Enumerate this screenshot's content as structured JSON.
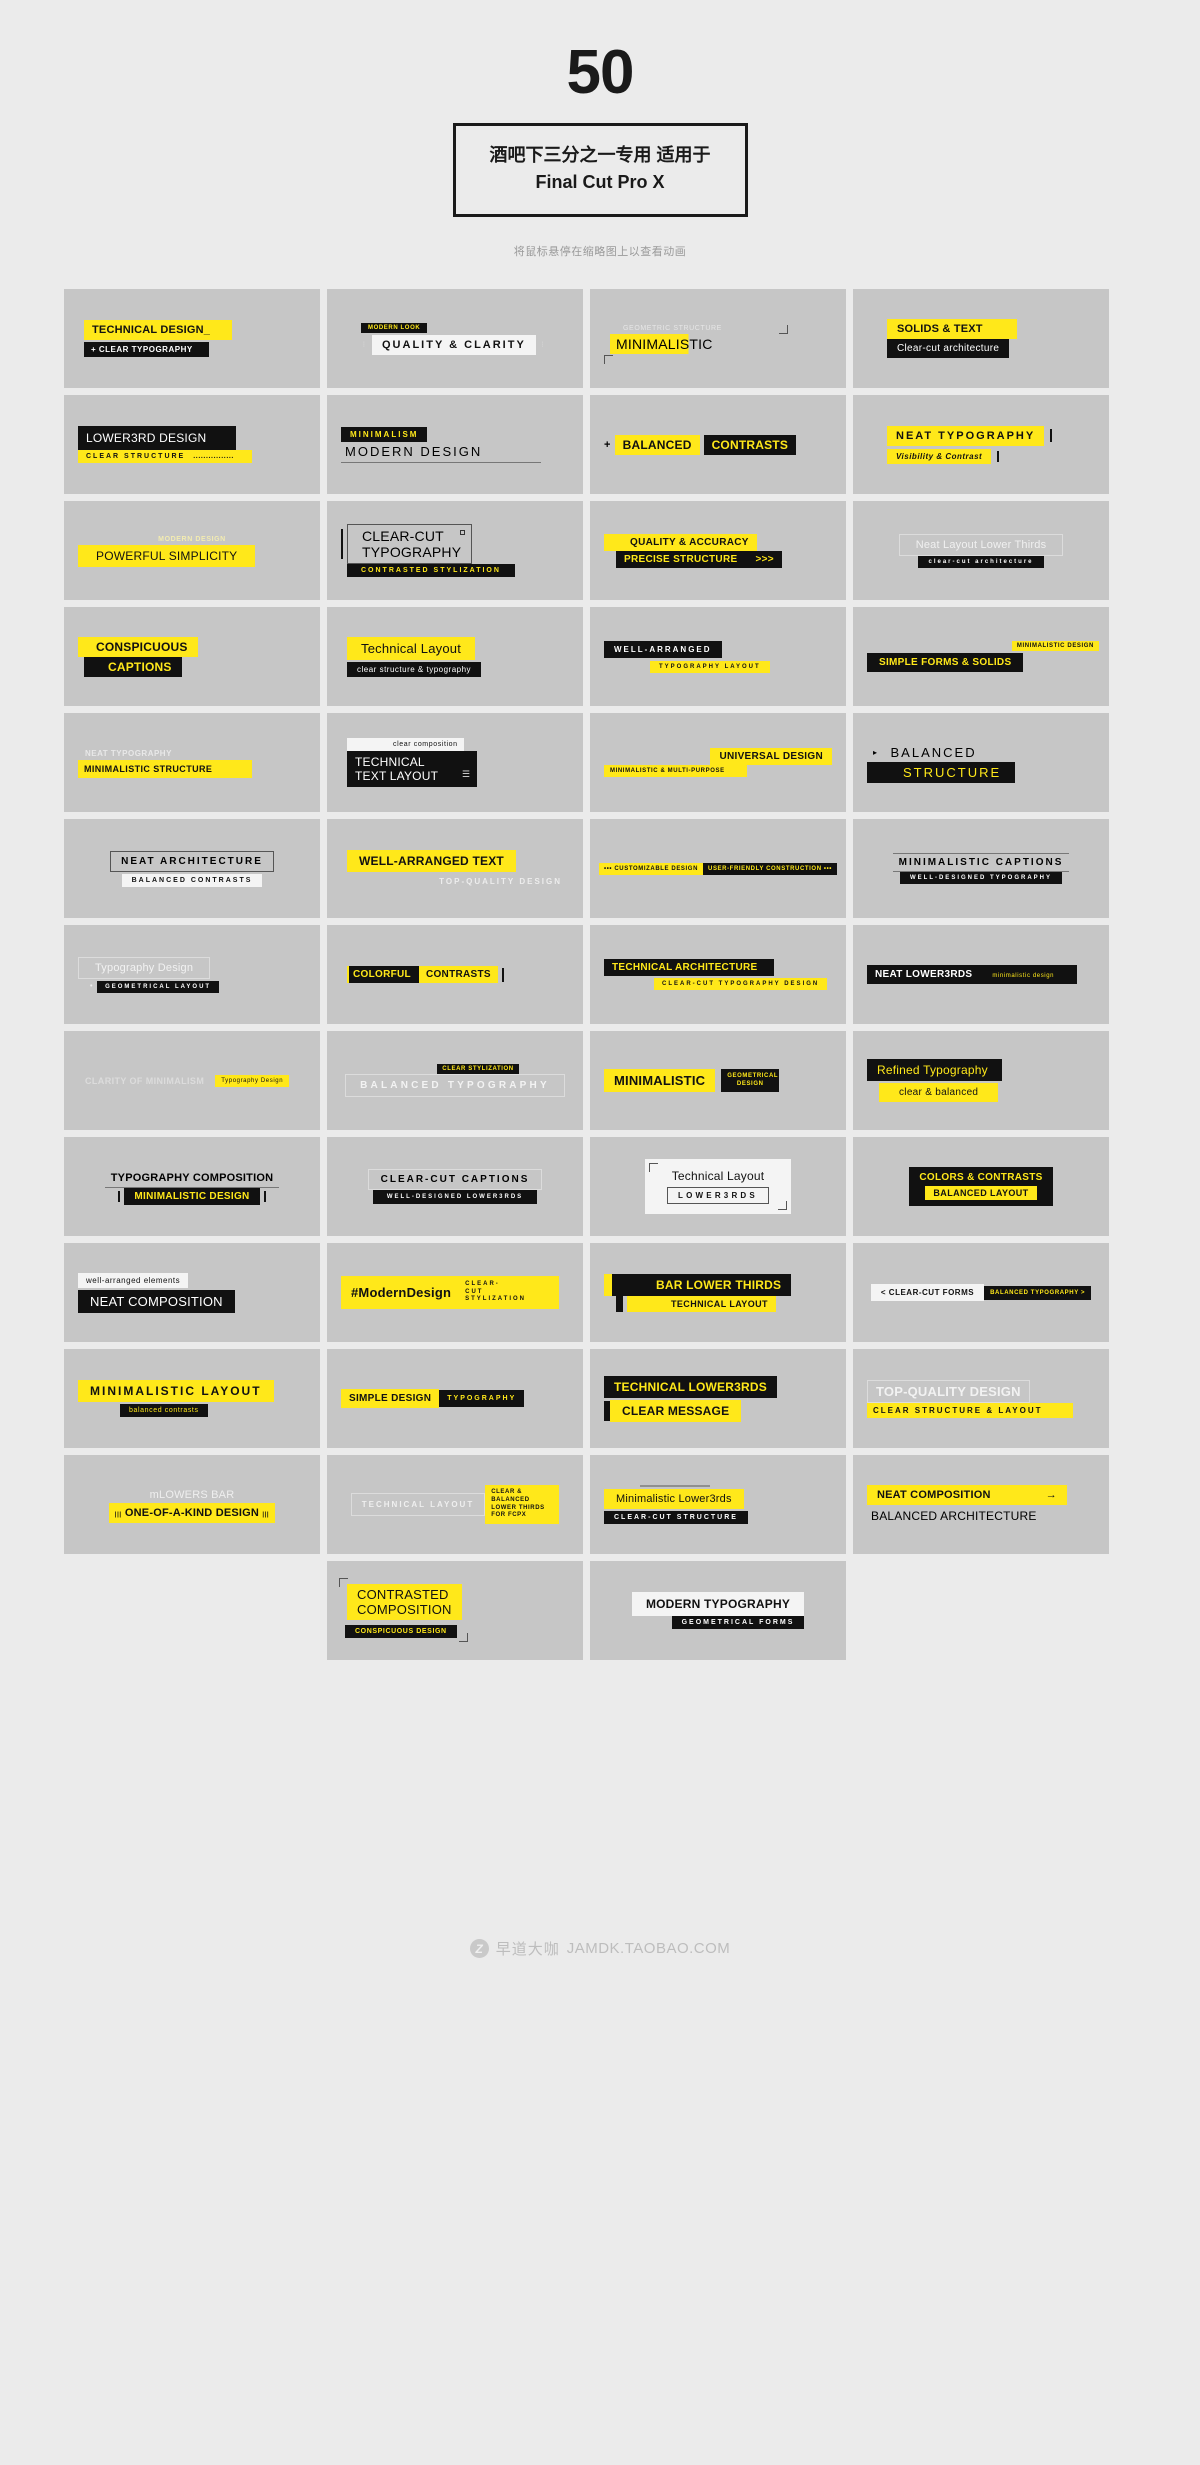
{
  "header": {
    "count": "50",
    "title_line1": "酒吧下三分之一专用 适用于",
    "title_line2": "Final Cut Pro X",
    "hover_note": "将鼠标悬停在缩略图上以查看动画"
  },
  "watermark": {
    "badge": "Z",
    "brand_cn": "早道大咖",
    "url": "JAMDK.TAOBAO.COM"
  },
  "colors": {
    "page_bg": "#ebebeb",
    "cell_bg": "#c6c6c6",
    "accent_yellow": "#ffe81a",
    "ink_black": "#111111",
    "white": "#f4f4f4"
  },
  "cards": [
    {
      "id": 1,
      "lines": [
        "TECHNICAL DESIGN_",
        "+ CLEAR TYPOGRAPHY"
      ]
    },
    {
      "id": 2,
      "lines": [
        "MODERN LOOK",
        "QUALITY & CLARITY"
      ]
    },
    {
      "id": 3,
      "lines": [
        "GEOMETRIC STRUCTURE",
        "MINIMALISTIC"
      ]
    },
    {
      "id": 4,
      "lines": [
        "SOLIDS & TEXT",
        "Clear-cut architecture"
      ]
    },
    {
      "id": 5,
      "lines": [
        "LOWER3RD DESIGN",
        "CLEAR STRUCTURE",
        "................"
      ]
    },
    {
      "id": 6,
      "lines": [
        "MINIMALISM",
        "MODERN DESIGN"
      ]
    },
    {
      "id": 7,
      "lines": [
        "+",
        "BALANCED",
        "CONTRASTS"
      ]
    },
    {
      "id": 8,
      "lines": [
        "NEAT TYPOGRAPHY",
        "Visibility & Contrast"
      ]
    },
    {
      "id": 9,
      "lines": [
        "MODERN DESIGN",
        "POWERFUL SIMPLICITY"
      ]
    },
    {
      "id": 10,
      "lines": [
        "CLEAR-CUT",
        "TYPOGRAPHY",
        "CONTRASTED STYLIZATION"
      ]
    },
    {
      "id": 11,
      "lines": [
        "QUALITY & ACCURACY",
        "PRECISE STRUCTURE",
        ">>>"
      ]
    },
    {
      "id": 12,
      "lines": [
        "Neat Layout Lower Thirds",
        "clear-cut architecture"
      ]
    },
    {
      "id": 13,
      "lines": [
        "CONSPICUOUS",
        "CAPTIONS"
      ]
    },
    {
      "id": 14,
      "lines": [
        "Technical Layout",
        "clear structure & typography"
      ]
    },
    {
      "id": 15,
      "lines": [
        "WELL-ARRANGED",
        "TYPOGRAPHY LAYOUT"
      ]
    },
    {
      "id": 16,
      "lines": [
        "MINIMALISTIC DESIGN",
        "SIMPLE FORMS & SOLIDS"
      ]
    },
    {
      "id": 17,
      "lines": [
        "NEAT TYPOGRAPHY",
        "MINIMALISTIC STRUCTURE"
      ]
    },
    {
      "id": 18,
      "lines": [
        "clear composition",
        "TECHNICAL",
        "TEXT LAYOUT"
      ]
    },
    {
      "id": 19,
      "lines": [
        "UNIVERSAL DESIGN",
        "MINIMALISTIC & MULTI-PURPOSE"
      ]
    },
    {
      "id": 20,
      "lines": [
        "BALANCED",
        "STRUCTURE"
      ]
    },
    {
      "id": 21,
      "lines": [
        "NEAT ARCHITECTURE",
        "BALANCED CONTRASTS"
      ]
    },
    {
      "id": 22,
      "lines": [
        "WELL-ARRANGED TEXT",
        "TOP-QUALITY DESIGN"
      ]
    },
    {
      "id": 23,
      "lines": [
        "CUSTOMIZABLE DESIGN",
        "USER-FRIENDLY CONSTRUCTION"
      ]
    },
    {
      "id": 24,
      "lines": [
        "MINIMALISTIC CAPTIONS",
        "WELL-DESIGNED TYPOGRAPHY"
      ]
    },
    {
      "id": 25,
      "lines": [
        "Typography Design",
        "GEOMETRICAL LAYOUT"
      ]
    },
    {
      "id": 26,
      "lines": [
        "COLORFUL",
        "CONTRASTS"
      ]
    },
    {
      "id": 27,
      "lines": [
        "TECHNICAL ARCHITECTURE",
        "CLEAR-CUT TYPOGRAPHY DESIGN"
      ]
    },
    {
      "id": 28,
      "lines": [
        "NEAT LOWER3RDS",
        "minimalistic design"
      ]
    },
    {
      "id": 29,
      "lines": [
        "CLARITY OF MINIMALISM",
        "Typography Design"
      ]
    },
    {
      "id": 30,
      "lines": [
        "CLEAR STYLIZATION",
        "BALANCED TYPOGRAPHY"
      ]
    },
    {
      "id": 31,
      "lines": [
        "MINIMALISTIC",
        "GEOMETRICAL DESIGN"
      ]
    },
    {
      "id": 32,
      "lines": [
        "Refined Typography",
        "clear & balanced"
      ]
    },
    {
      "id": 33,
      "lines": [
        "TYPOGRAPHY COMPOSITION",
        "MINIMALISTIC DESIGN"
      ]
    },
    {
      "id": 34,
      "lines": [
        "CLEAR-CUT CAPTIONS",
        "WELL-DESIGNED LOWER3RDS"
      ]
    },
    {
      "id": 35,
      "lines": [
        "Technical Layout",
        "LOWER3RDS"
      ]
    },
    {
      "id": 36,
      "lines": [
        "COLORS & CONTRASTS",
        "BALANCED LAYOUT"
      ]
    },
    {
      "id": 37,
      "lines": [
        "well-arranged elements",
        "NEAT COMPOSITION"
      ]
    },
    {
      "id": 38,
      "lines": [
        "#ModernDesign",
        "CLEAR-CUT STYLIZATION"
      ]
    },
    {
      "id": 39,
      "lines": [
        "BAR LOWER THIRDS",
        "TECHNICAL LAYOUT"
      ]
    },
    {
      "id": 40,
      "lines": [
        "< CLEAR-CUT FORMS",
        "BALANCED TYPOGRAPHY >"
      ]
    },
    {
      "id": 41,
      "lines": [
        "MINIMALISTIC LAYOUT",
        "balanced contrasts"
      ]
    },
    {
      "id": 42,
      "lines": [
        "SIMPLE DESIGN",
        "TYPOGRAPHY"
      ]
    },
    {
      "id": 43,
      "lines": [
        "TECHNICAL LOWER3RDS",
        "CLEAR MESSAGE"
      ]
    },
    {
      "id": 44,
      "lines": [
        "TOP-QUALITY DESIGN",
        "CLEAR STRUCTURE & LAYOUT"
      ]
    },
    {
      "id": 45,
      "lines": [
        "mLOWERS BAR",
        "ONE-OF-A-KIND DESIGN",
        "|||"
      ]
    },
    {
      "id": 46,
      "lines": [
        "TECHNICAL LAYOUT",
        "CLEAR & BALANCED LOWER THIRDS FOR FCPX"
      ]
    },
    {
      "id": 47,
      "lines": [
        "Minimalistic Lower3rds",
        "CLEAR-CUT STRUCTURE"
      ]
    },
    {
      "id": 48,
      "lines": [
        "NEAT COMPOSITION",
        "BALANCED ARCHITECTURE",
        "→"
      ]
    },
    {
      "id": 49,
      "lines": [
        "CONTRASTED",
        "COMPOSITION",
        "CONSPICUOUS DESIGN"
      ]
    },
    {
      "id": 50,
      "lines": [
        "MODERN TYPOGRAPHY",
        "GEOMETRICAL FORMS"
      ]
    }
  ]
}
